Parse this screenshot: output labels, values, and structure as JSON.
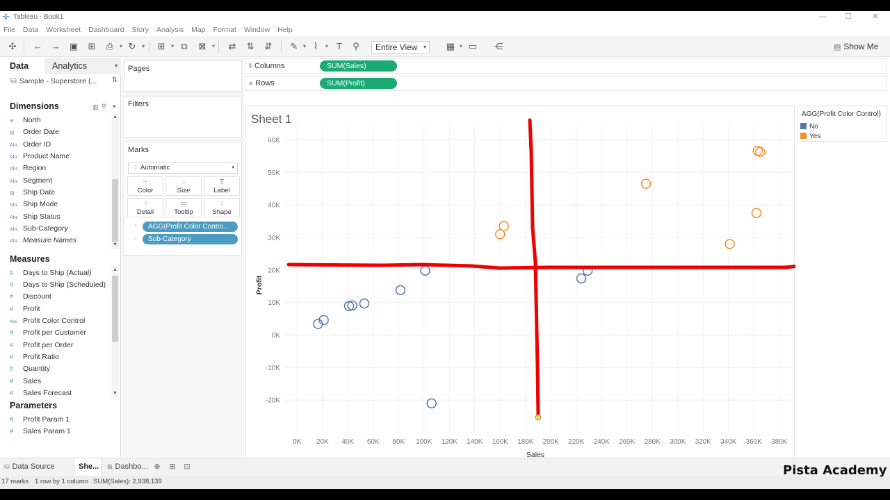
{
  "window": {
    "title": "Tableau - Book1",
    "min": "—",
    "max": "☐",
    "close": "✕"
  },
  "menu": [
    "File",
    "Data",
    "Worksheet",
    "Dashboard",
    "Story",
    "Analysis",
    "Map",
    "Format",
    "Window",
    "Help"
  ],
  "toolbar": {
    "view_select": "Entire View",
    "show_me": "Show Me"
  },
  "data_pane": {
    "tab_data": "Data",
    "tab_analytics": "Analytics",
    "source": "Sample - Superstore (...",
    "dimensions_header": "Dimensions",
    "dimensions": [
      {
        "icon": "⊕",
        "label": "North"
      },
      {
        "icon": "▤",
        "label": "Order Date"
      },
      {
        "icon": "Abc",
        "label": "Order ID"
      },
      {
        "icon": "Abc",
        "label": "Product Name"
      },
      {
        "icon": "Abc",
        "label": "Region"
      },
      {
        "icon": "Abc",
        "label": "Segment"
      },
      {
        "icon": "▤",
        "label": "Ship Date"
      },
      {
        "icon": "Abc",
        "label": "Ship Mode"
      },
      {
        "icon": "Abc",
        "label": "Ship Status"
      },
      {
        "icon": "Abc",
        "label": "Sub-Category"
      },
      {
        "icon": "Abc",
        "label": "Measure Names"
      }
    ],
    "measures_header": "Measures",
    "measures": [
      {
        "icon": "#",
        "label": "Days to Ship (Actual)"
      },
      {
        "icon": "#",
        "label": "Days to Ship (Scheduled)"
      },
      {
        "icon": "#",
        "label": "Discount"
      },
      {
        "icon": "#",
        "label": "Profit"
      },
      {
        "icon": "Abc",
        "label": "Profit Color Control"
      },
      {
        "icon": "#",
        "label": "Profit per Customer"
      },
      {
        "icon": "#",
        "label": "Profit per Order"
      },
      {
        "icon": "#",
        "label": "Profit Ratio"
      },
      {
        "icon": "#",
        "label": "Quantity"
      },
      {
        "icon": "#",
        "label": "Sales"
      },
      {
        "icon": "#",
        "label": "Sales Forecast"
      }
    ],
    "parameters_header": "Parameters",
    "parameters": [
      {
        "icon": "#",
        "label": "Profit Param 1"
      },
      {
        "icon": "#",
        "label": "Sales Param 1"
      }
    ]
  },
  "cards": {
    "pages": "Pages",
    "filters": "Filters",
    "marks": "Marks",
    "mark_type": "Automatic",
    "mark_buttons": [
      {
        "label": "Color",
        "icon": "⁘"
      },
      {
        "label": "Size",
        "icon": "◌"
      },
      {
        "label": "Label",
        "icon": "T"
      },
      {
        "label": "Detail",
        "icon": "⁖"
      },
      {
        "label": "Tooltip",
        "icon": "▭"
      },
      {
        "label": "Shape",
        "icon": "⁘"
      }
    ],
    "mark_pills": [
      "AGG(Profit Color Contro..",
      "Sub-Category"
    ]
  },
  "shelves": {
    "columns_label": "Columns",
    "columns_pill": "SUM(Sales)",
    "rows_label": "Rows",
    "rows_pill": "SUM(Profit)"
  },
  "sheet_title": "Sheet 1",
  "legend": {
    "title": "AGG(Profit Color Control)",
    "items": [
      {
        "label": "No",
        "color": "#4e79a7"
      },
      {
        "label": "Yes",
        "color": "#f28e2b"
      }
    ]
  },
  "chart_data": {
    "type": "scatter",
    "xlabel": "Sales",
    "ylabel": "Profit",
    "xlim": [
      -10000,
      390000
    ],
    "ylim": [
      -30000,
      65000
    ],
    "x_ticks": [
      0,
      20000,
      40000,
      60000,
      80000,
      100000,
      120000,
      140000,
      160000,
      180000,
      200000,
      220000,
      240000,
      260000,
      280000,
      300000,
      320000,
      340000,
      360000,
      380000
    ],
    "x_tick_labels": [
      "0K",
      "20K",
      "40K",
      "60K",
      "80K",
      "100K",
      "120K",
      "140K",
      "160K",
      "180K",
      "200K",
      "220K",
      "240K",
      "260K",
      "280K",
      "300K",
      "320K",
      "340K",
      "360K",
      "380K"
    ],
    "y_ticks": [
      -20000,
      -10000,
      0,
      10000,
      20000,
      30000,
      40000,
      50000,
      60000
    ],
    "y_tick_labels": [
      "-20K",
      "-10K",
      "0K",
      "10K",
      "20K",
      "30K",
      "40K",
      "50K",
      "60K"
    ],
    "grid": true,
    "series": [
      {
        "name": "No",
        "color": "#4e79a7",
        "x": [
          16500,
          21000,
          41000,
          43500,
          53000,
          81500,
          101000,
          106000,
          224000,
          229000
        ],
        "y": [
          3400,
          4600,
          8900,
          9100,
          9700,
          13800,
          19800,
          -21000,
          17400,
          19800
        ]
      },
      {
        "name": "Yes",
        "color": "#f28e2b",
        "x": [
          160000,
          163000,
          275000,
          341000,
          362000,
          363000,
          365000
        ],
        "y": [
          31000,
          33500,
          46500,
          28000,
          37500,
          56600,
          56300
        ]
      }
    ],
    "annotation_lines": [
      {
        "orientation": "horizontal",
        "y": 20800,
        "color": "#ee0000"
      },
      {
        "orientation": "vertical",
        "x": 190000,
        "color": "#ee0000"
      }
    ]
  },
  "sheet_tabs": {
    "data_source": "Data Source",
    "sheet": "She...",
    "dashboard": "Dashbo..."
  },
  "status": {
    "marks": "17 marks",
    "rows": "1 row by 1 column",
    "sum": "SUM(Sales): 2,938,139"
  },
  "watermark": "Pista Academy"
}
